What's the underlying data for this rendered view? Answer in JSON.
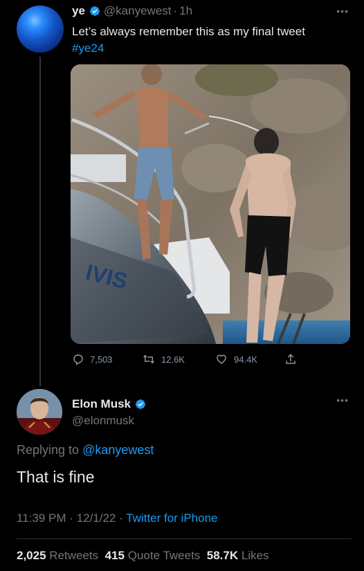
{
  "tweet1": {
    "name": "ye",
    "handle": "@kanyewest",
    "separator": "·",
    "time": "1h",
    "text": "Let’s always remember this as my final tweet",
    "hashtag": "#ye24",
    "photo_boat_text": "IVIS",
    "actions": {
      "replies": "7,503",
      "retweets": "12.6K",
      "likes": "94.4K"
    }
  },
  "reply": {
    "name": "Elon Musk",
    "handle": "@elonmusk",
    "replying_prefix": "Replying to",
    "replying_to": "@kanyewest",
    "text": "That is fine",
    "time": "11:39 PM",
    "dot": "·",
    "date": "12/1/22",
    "source": "Twitter for iPhone",
    "stats": {
      "retweets_count": "2,025",
      "retweets_label": "Retweets",
      "quotes_count": "415",
      "quotes_label": "Quote Tweets",
      "likes_count": "58.7K",
      "likes_label": "Likes"
    }
  },
  "colors": {
    "background": "#000000",
    "text": "#e7e9ea",
    "muted": "#71767b",
    "accent": "#1d9bf0"
  },
  "icons": [
    "verified-badge-icon",
    "more-icon",
    "reply-icon",
    "retweet-icon",
    "like-icon",
    "share-icon"
  ]
}
